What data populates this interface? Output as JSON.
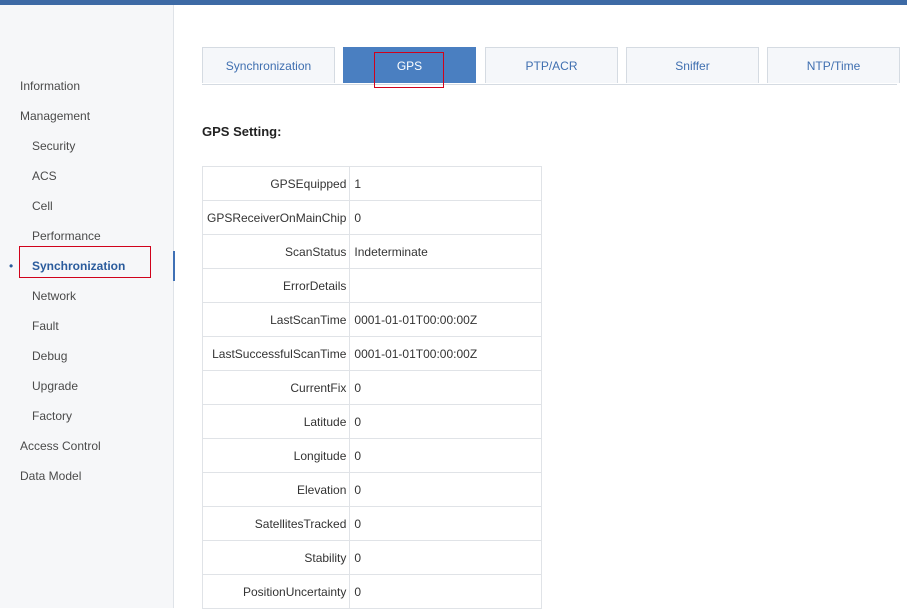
{
  "colors": {
    "accent": "#4a7fc1",
    "topbar": "#3d6aa5",
    "highlight": "#d0021b"
  },
  "sidebar": {
    "items": [
      {
        "label": "Information",
        "level": 0,
        "active": false
      },
      {
        "label": "Management",
        "level": 0,
        "active": false
      },
      {
        "label": "Security",
        "level": 1,
        "active": false
      },
      {
        "label": "ACS",
        "level": 1,
        "active": false
      },
      {
        "label": "Cell",
        "level": 1,
        "active": false
      },
      {
        "label": "Performance",
        "level": 1,
        "active": false
      },
      {
        "label": "Synchronization",
        "level": 1,
        "active": true
      },
      {
        "label": "Network",
        "level": 1,
        "active": false
      },
      {
        "label": "Fault",
        "level": 1,
        "active": false
      },
      {
        "label": "Debug",
        "level": 1,
        "active": false
      },
      {
        "label": "Upgrade",
        "level": 1,
        "active": false
      },
      {
        "label": "Factory",
        "level": 1,
        "active": false
      },
      {
        "label": "Access Control",
        "level": 0,
        "active": false
      },
      {
        "label": "Data Model",
        "level": 0,
        "active": false
      }
    ],
    "active_marker": "•"
  },
  "tabs": [
    {
      "label": "Synchronization",
      "active": false
    },
    {
      "label": "GPS",
      "active": true
    },
    {
      "label": "PTP/ACR",
      "active": false
    },
    {
      "label": "Sniffer",
      "active": false
    },
    {
      "label": "NTP/Time",
      "active": false
    }
  ],
  "main": {
    "section_title": "GPS Setting:",
    "rows": [
      {
        "key": "GPSEquipped",
        "value": "1"
      },
      {
        "key": "GPSReceiverOnMainChip",
        "value": "0"
      },
      {
        "key": "ScanStatus",
        "value": "Indeterminate"
      },
      {
        "key": "ErrorDetails",
        "value": ""
      },
      {
        "key": "LastScanTime",
        "value": "0001-01-01T00:00:00Z"
      },
      {
        "key": "LastSuccessfulScanTime",
        "value": "0001-01-01T00:00:00Z"
      },
      {
        "key": "CurrentFix",
        "value": "0"
      },
      {
        "key": "Latitude",
        "value": "0"
      },
      {
        "key": "Longitude",
        "value": "0"
      },
      {
        "key": "Elevation",
        "value": "0"
      },
      {
        "key": "SatellitesTracked",
        "value": "0"
      },
      {
        "key": "Stability",
        "value": "0"
      },
      {
        "key": "PositionUncertainty",
        "value": "0"
      }
    ]
  }
}
